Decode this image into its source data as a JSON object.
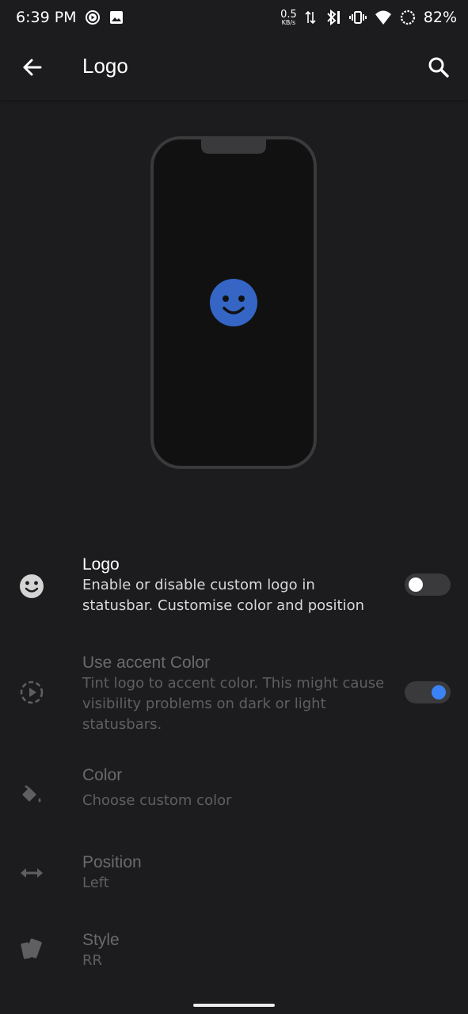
{
  "status_bar": {
    "time": "6:39 PM",
    "net_speed_value": "0.5",
    "net_speed_unit": "KB/s",
    "battery": "82%"
  },
  "app_bar": {
    "title": "Logo",
    "back_icon": "arrow-left-icon",
    "search_icon": "search-icon"
  },
  "preview": {
    "logo_icon": "smiley-face-icon",
    "logo_color": "#3566c6"
  },
  "settings": [
    {
      "key": "logo",
      "title": "Logo",
      "summary": "Enable or disable custom logo in statusbar. Customise color and position",
      "icon": "smiley-face-icon",
      "toggle": false,
      "enabled": true
    },
    {
      "key": "accent",
      "title": "Use accent Color",
      "summary": "Tint logo to accent color. This might cause visibility problems on dark or light statusbars.",
      "icon": "play-circle-dashed-icon",
      "toggle": true,
      "enabled": false
    },
    {
      "key": "color",
      "title": "Color",
      "summary": "Choose custom color",
      "icon": "paint-bucket-icon",
      "enabled": false
    },
    {
      "key": "position",
      "title": "Position",
      "summary": "Left",
      "icon": "horizontal-arrows-icon",
      "enabled": false
    },
    {
      "key": "style",
      "title": "Style",
      "summary": "RR",
      "icon": "style-cards-icon",
      "enabled": false
    }
  ],
  "colors": {
    "background": "#1c1c1e",
    "accent": "#3b82f6",
    "logo_blue": "#3566c6",
    "disabled_text": "#6a6a6c"
  }
}
